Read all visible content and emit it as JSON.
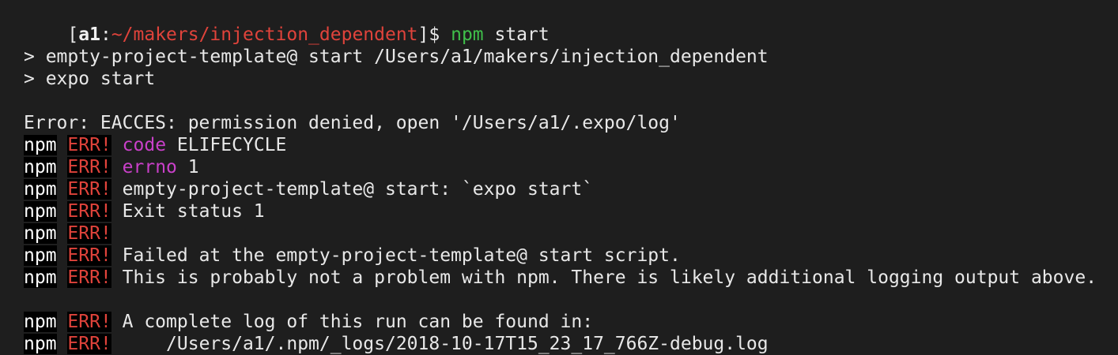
{
  "prompt": {
    "open_bracket": "[",
    "user": "a1",
    "colon": ":",
    "path": "~/makers/injection_dependent",
    "close_bracket": "]$ ",
    "command": "npm",
    "args": " start"
  },
  "script_header": [
    "> empty-project-template@ start /Users/a1/makers/injection_dependent",
    "> expo start"
  ],
  "error_line": "Error: EACCES: permission denied, open '/Users/a1/.expo/log'",
  "npm_label": "npm",
  "err_label": "ERR!",
  "npm_err_lines": [
    {
      "key": "code",
      "value": " ELIFECYCLE"
    },
    {
      "key": "errno",
      "value": " 1"
    },
    {
      "key": "",
      "value": " empty-project-template@ start: `expo start`"
    },
    {
      "key": "",
      "value": " Exit status 1"
    },
    {
      "key": "",
      "value": ""
    },
    {
      "key": "",
      "value": " Failed at the empty-project-template@ start script."
    },
    {
      "key": "",
      "value": " This is probably not a problem with npm. There is likely additional logging output above."
    }
  ],
  "log_lines": [
    {
      "key": "",
      "value": " A complete log of this run can be found in:"
    },
    {
      "key": "",
      "value": "     /Users/a1/.npm/_logs/2018-10-17T15_23_17_766Z-debug.log"
    }
  ],
  "colors": {
    "background": "#1e1e1e",
    "text": "#e8e8e8",
    "error_red": "#e0433b",
    "command_green": "#3fbf4a",
    "key_magenta": "#c940c9"
  }
}
